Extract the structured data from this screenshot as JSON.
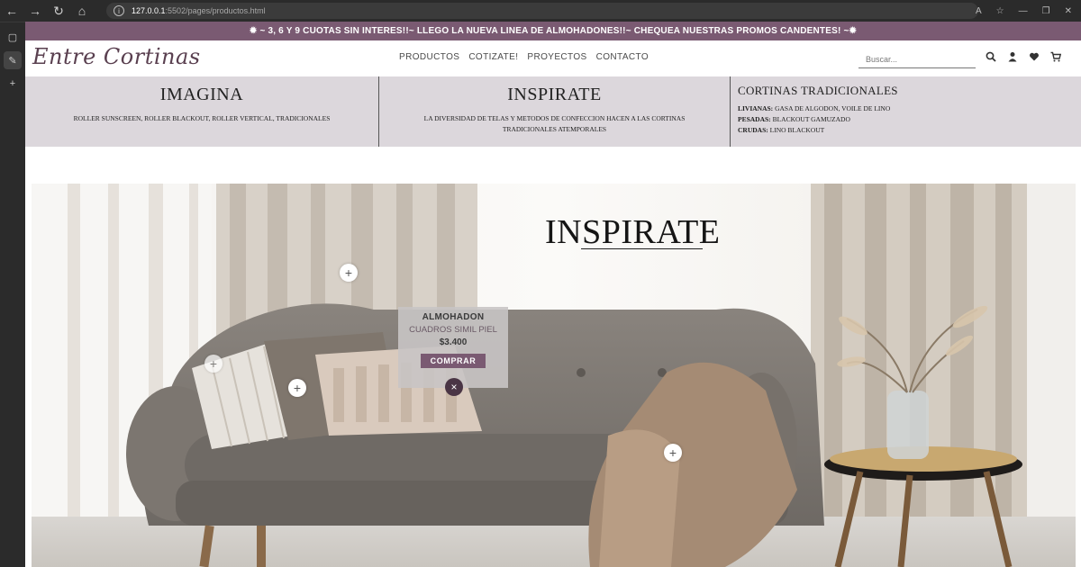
{
  "browser": {
    "url_host": "127.0.0.1",
    "url_path": ":5502/pages/productos.html"
  },
  "promo": {
    "text": "✹ ~ 3, 6 Y 9 CUOTAS SIN INTERES!!~ LLEGO LA NUEVA LINEA DE ALMOHADONES!!~ CHEQUEA NUESTRAS PROMOS CANDENTES! ~✹"
  },
  "header": {
    "logo": "Entre Cortinas",
    "nav": [
      "PRODUCTOS",
      "COTIZATE!",
      "PROYECTOS",
      "CONTACTO"
    ],
    "search_placeholder": "Buscar..."
  },
  "band": {
    "col1": {
      "title": "IMAGINA",
      "text": "ROLLER SUNSCREEN, ROLLER BLACKOUT, ROLLER VERTICAL, TRADICIONALES"
    },
    "col2": {
      "title": "INSPIRATE",
      "text": "LA DIVERSIDAD DE TELAS Y METODOS DE CONFECCION HACEN A LAS CORTINAS TRADICIONALES ATEMPORALES"
    },
    "col3": {
      "title": "CORTINAS TRADICIONALES",
      "lines": [
        {
          "label": "LIVIANAS:",
          "value": " GASA DE ALGODON, VOILE DE LINO"
        },
        {
          "label": "PESADAS:",
          "value": " BLACKOUT GAMUZADO"
        },
        {
          "label": "CRUDAS:",
          "value": " LINO BLACKOUT"
        }
      ]
    }
  },
  "hero": {
    "title": "INSPIRATE",
    "popup": {
      "name": "ALMOHADON",
      "desc": "CUADROS SIMIL PIEL",
      "price": "$3.400",
      "buy": "COMPRAR"
    },
    "hotspot_symbol": "+",
    "close_symbol": "×"
  },
  "colors": {
    "accent": "#7a5a72",
    "band": "#dcd7dc"
  }
}
